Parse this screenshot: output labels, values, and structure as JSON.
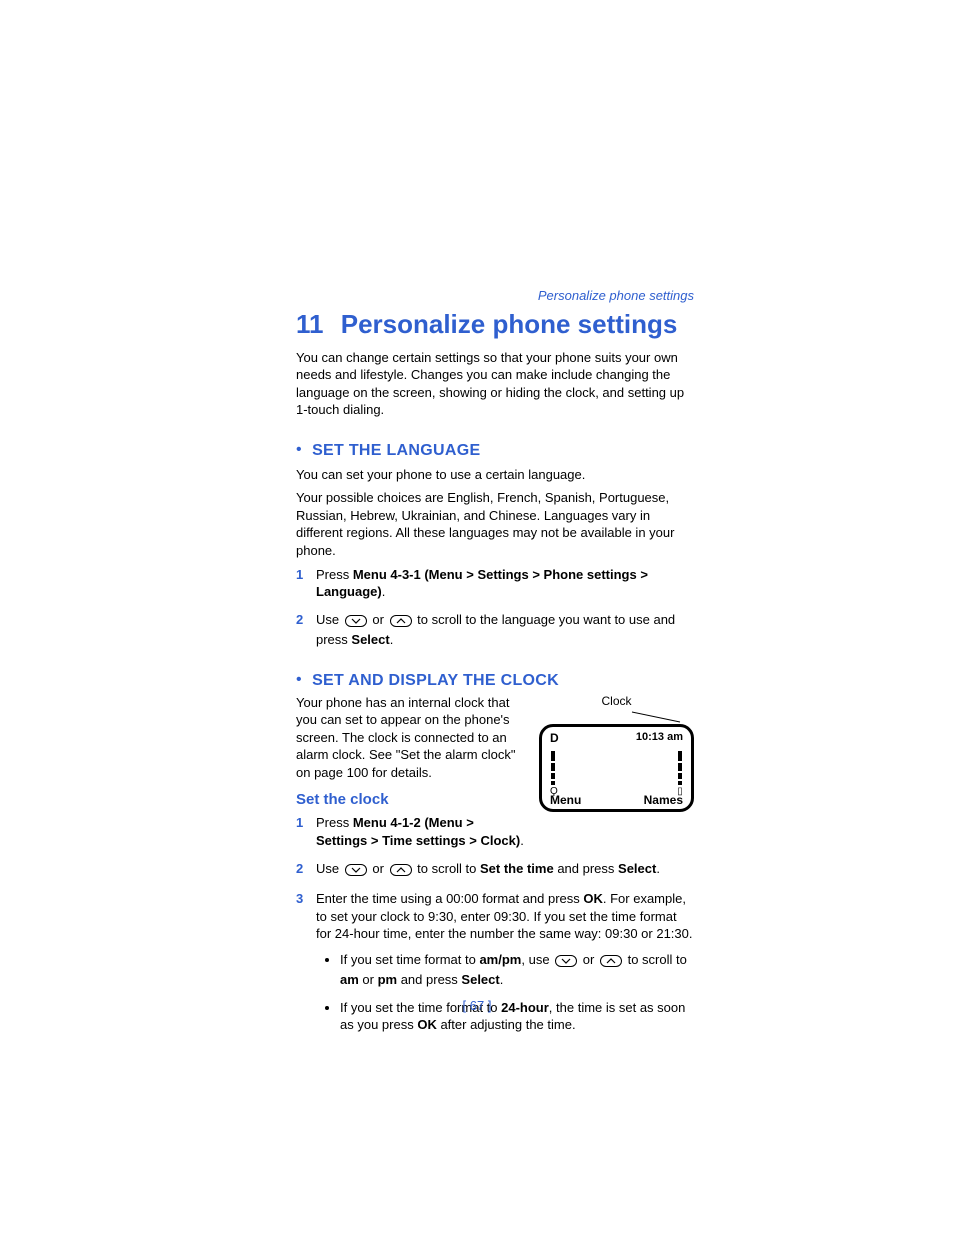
{
  "running_head": "Personalize phone settings",
  "chapter": {
    "num": "11",
    "title": "Personalize phone settings"
  },
  "intro": "You can change certain settings so that your phone suits your own needs and lifestyle. Changes you can make include changing the language on the screen, showing or hiding the clock, and setting up 1-touch dialing.",
  "lang": {
    "heading": "SET THE LANGUAGE",
    "p1": "You can set your phone to use a certain language.",
    "p2": "Your possible choices are English, French, Spanish, Portuguese, Russian, Hebrew, Ukrainian, and Chinese. Languages vary in different regions. All these languages may not be available in your phone.",
    "step1_pre": "Press ",
    "step1_bold": "Menu 4-3-1 (Menu > Settings > Phone settings > Language)",
    "step1_post": ".",
    "step2_pre": "Use ",
    "step2_mid": " or ",
    "step2_post": " to scroll to the language you want to use and press ",
    "step2_select": "Select",
    "step2_end": "."
  },
  "clock": {
    "heading": "SET AND DISPLAY THE CLOCK",
    "p1": "Your phone has an internal clock that you can set to appear on the phone's screen. The clock is connected to an alarm clock. See \"Set the alarm clock\" on page 100 for details.",
    "fig_label": "Clock",
    "fig_D": "D",
    "fig_time": "10:13 am",
    "fig_menu": "Menu",
    "fig_names": "Names",
    "subhead": "Set the clock",
    "step1_pre": "Press ",
    "step1_bold": "Menu 4-1-2 (Menu > Settings > Time settings > Clock)",
    "step1_post": ".",
    "step2_pre": "Use ",
    "step2_mid": " or ",
    "step2_post1": " to scroll to ",
    "step2_setthetime": "Set the time",
    "step2_post2": " and press ",
    "step2_select": "Select",
    "step2_end": ".",
    "step3_pre": "Enter the time using a 00:00 format and press ",
    "step3_ok": "OK",
    "step3_post": ". For example, to set your clock to 9:30, enter 09:30. If you set the time format for 24-hour time, enter the number the same way: 09:30 or 21:30.",
    "sub1_pre": "If you set time format to ",
    "sub1_ampm": "am/pm",
    "sub1_mid1": ", use ",
    "sub1_mid2": " or ",
    "sub1_mid3": " to scroll to ",
    "sub1_am": "am",
    "sub1_or": " or ",
    "sub1_pm": "pm",
    "sub1_mid4": " and press ",
    "sub1_select": "Select",
    "sub1_end": ".",
    "sub2_pre": "If you set the time format to ",
    "sub2_24h": "24-hour",
    "sub2_mid": ", the time is set as soon as you press ",
    "sub2_ok": "OK",
    "sub2_post": " after adjusting the time."
  },
  "page_number": "[ 67 ]"
}
